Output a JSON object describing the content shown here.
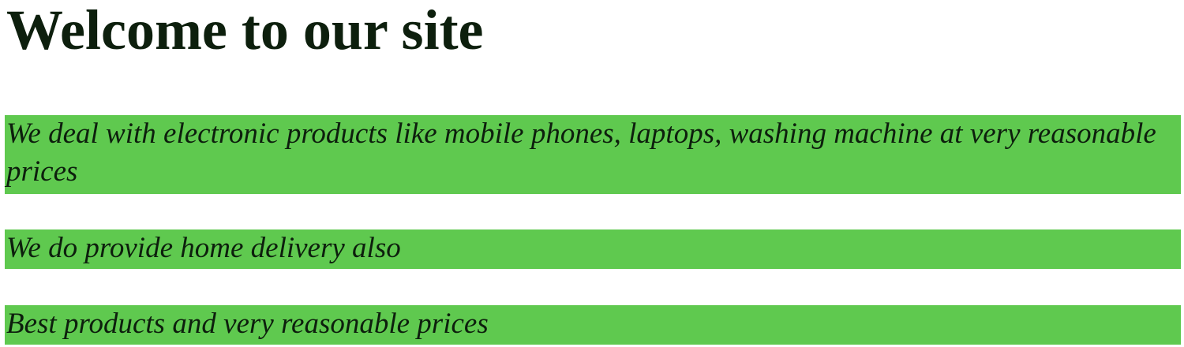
{
  "page": {
    "heading": "Welcome to our site",
    "paragraphs": [
      "We deal with electronic products like mobile phones, laptops, washing machine at very reasonable prices",
      "We do provide home delivery also",
      "Best products and very reasonable prices"
    ]
  },
  "colors": {
    "paragraph_background": "#5fc94f",
    "text": "#0d1f0d",
    "page_background": "#ffffff"
  }
}
